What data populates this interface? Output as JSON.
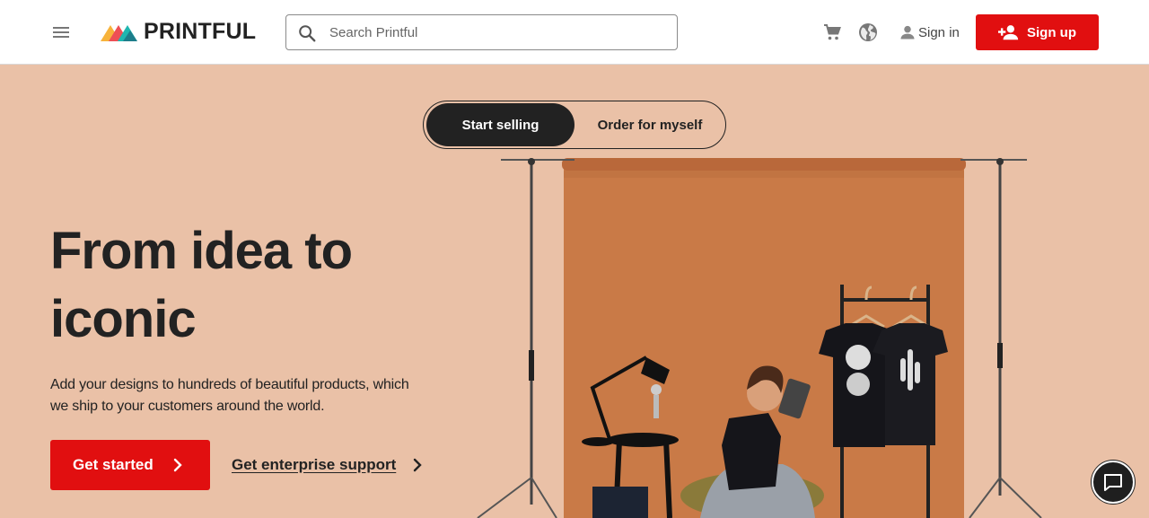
{
  "header": {
    "logo_text": "PRINTFUL",
    "search": {
      "placeholder": "Search Printful",
      "value": ""
    },
    "icons": [
      "menu-icon",
      "search-icon",
      "cart-icon",
      "globe-icon",
      "user-icon",
      "add-user-icon"
    ],
    "sign_in_label": "Sign in",
    "sign_up_label": "Sign up"
  },
  "hero": {
    "toggle": {
      "active": "Start selling",
      "inactive": "Order for myself"
    },
    "headline": "From idea to iconic",
    "subtext": "Add your designs to hundreds of beautiful products, which we ship to your customers around the world.",
    "cta_primary": "Get started",
    "cta_secondary": "Get enterprise support"
  },
  "colors": {
    "brand_red": "#e10f10",
    "hero_bg": "#eac1a7",
    "backdrop": "#c97a47",
    "dark": "#222222"
  },
  "chat": {
    "icon": "chat-icon"
  }
}
